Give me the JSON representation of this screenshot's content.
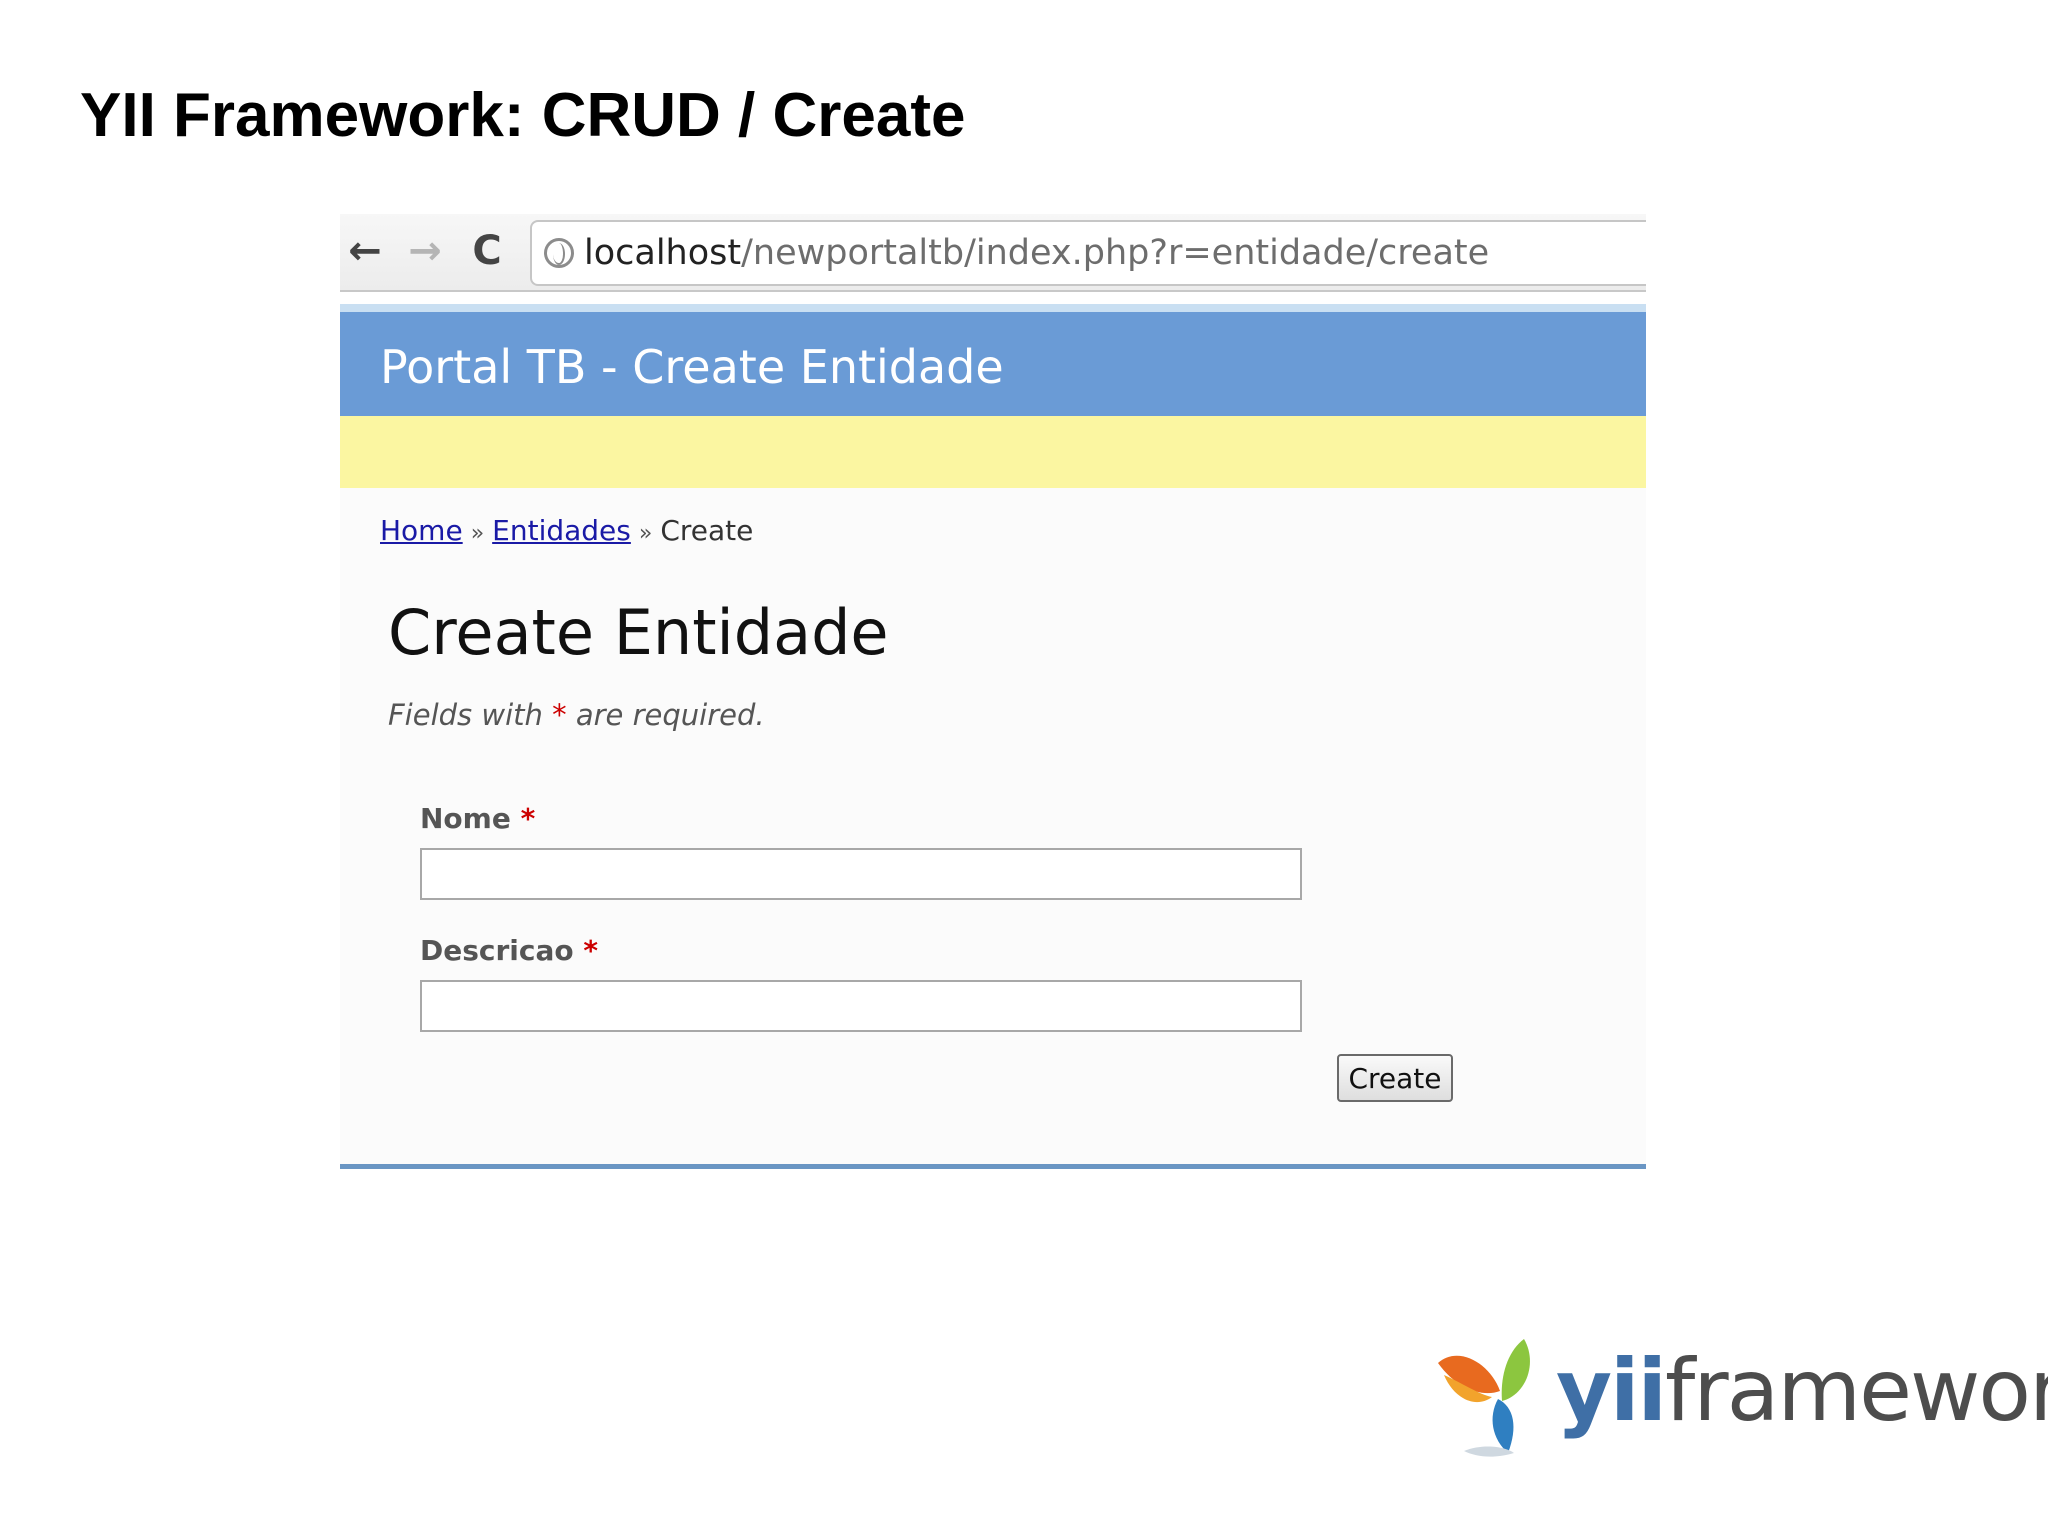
{
  "slide": {
    "title": "YII Framework: CRUD / Create"
  },
  "browser": {
    "url_host": "localhost",
    "url_path": "/newportaltb/index.php?r=entidade/create",
    "nav": {
      "back": "←",
      "forward": "→",
      "reload": "C"
    }
  },
  "app": {
    "header_title": "Portal TB - Create Entidade",
    "breadcrumbs": [
      {
        "label": "Home",
        "link": true
      },
      {
        "label": "Entidades",
        "link": true
      },
      {
        "label": "Create",
        "link": false
      }
    ],
    "breadcrumb_separator": "»",
    "page_heading": "Create Entidade",
    "note": {
      "prefix": "Fields with",
      "asterisk": "*",
      "suffix": "are required."
    },
    "form": {
      "fields": [
        {
          "label": "Nome",
          "required_mark": "*",
          "value": ""
        },
        {
          "label": "Descricao",
          "required_mark": "*",
          "value": ""
        }
      ],
      "submit_label": "Create"
    },
    "colors": {
      "header": "#6a9bd6",
      "menu": "#fbf6a1",
      "link": "#1a1aa6",
      "required": "#cc0000"
    }
  },
  "logo": {
    "yii": "yii",
    "framework": "framework"
  }
}
